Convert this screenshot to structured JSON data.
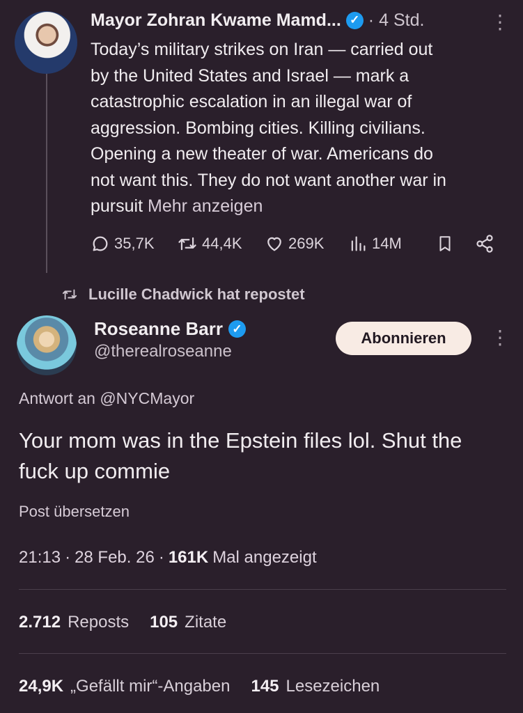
{
  "post": {
    "author_name": "Mayor Zohran Kwame Mamd...",
    "time": "4 Std.",
    "text_lines": [
      "Today’s military strikes on Iran — carried out",
      "by the United States and Israel — mark a",
      "catastrophic escalation in an illegal war of",
      "aggression. Bombing cities. Killing civilians.",
      "Opening a new theater of war.  Americans do",
      "not want this. They do not want another war in"
    ],
    "last_line_prefix": "pursuit",
    "show_more": "Mehr anzeigen",
    "replies": "35,7K",
    "reposts": "44,4K",
    "likes": "269K",
    "views": "14M"
  },
  "repost_banner": "Lucille Chadwick hat repostet",
  "reply": {
    "author_name": "Roseanne Barr",
    "handle": "@therealroseanne",
    "follow_label": "Abonnieren",
    "reply_to": "Antwort an @NYCMayor",
    "text": "Your mom was in the Epstein files lol. Shut the fuck up commie",
    "translate": "Post übersetzen",
    "time": "21:13",
    "date": "28 Feb. 26",
    "views": "161K",
    "views_label": "Mal angezeigt"
  },
  "stats": {
    "reposts": "2.712",
    "reposts_label": "Reposts",
    "quotes": "105",
    "quotes_label": "Zitate",
    "likes": "24,9K",
    "likes_label": "„Gefällt mir“-Angaben",
    "bookmarks": "145",
    "bookmarks_label": "Lesezeichen"
  },
  "icons": {
    "verified": "verified-badge-icon",
    "reply": "reply-icon",
    "repost": "repost-icon",
    "like": "heart-icon",
    "views": "views-icon",
    "bookmark": "bookmark-icon",
    "share": "share-icon",
    "more": "more-icon"
  },
  "colors": {
    "background": "#2a1f2b",
    "verified": "#1d9bf0",
    "follow_button": "#f8ebe4"
  }
}
